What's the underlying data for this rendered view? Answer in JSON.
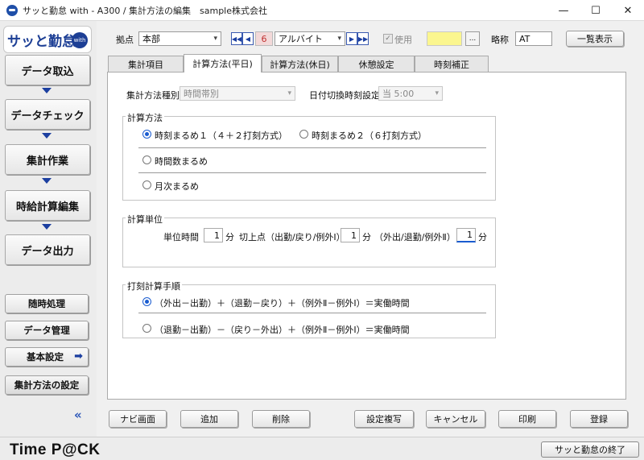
{
  "window": {
    "title": "サッと勤怠 with - A300 / 集計方法の編集　sample株式会社",
    "minimize": "—",
    "maximize": "☐",
    "close": "✕"
  },
  "sidebar": {
    "logo_text": "サッと勤怠",
    "logo_badge": "with",
    "nav": [
      "データ取込",
      "データチェック",
      "集計作業",
      "時給計算編集",
      "データ出力"
    ],
    "sub": [
      "随時処理",
      "データ管理",
      "基本設定",
      "集計方法の設定"
    ],
    "settings_arrow": "➡",
    "collapse": "«"
  },
  "toolbar": {
    "base_label": "拠点",
    "base_value": "本部",
    "prev_btns": [
      "◀◀",
      "◀"
    ],
    "number": "6",
    "type_value": "アルバイト",
    "next_btns": [
      "▶",
      "▶▶"
    ],
    "use_label": "使用",
    "use_check": "✓",
    "ellipsis": "...",
    "abbr_label": "略称",
    "abbr_value": "AT",
    "list_button": "一覧表示"
  },
  "tabs": [
    "集計項目",
    "計算方法(平日)",
    "計算方法(休日)",
    "休憩設定",
    "時刻補正"
  ],
  "form": {
    "method_type_label": "集計方法種別",
    "method_type_value": "時間帯別",
    "date_switch_label": "日付切換時刻設定",
    "date_switch_value": "当 5:00",
    "calc_method_title": "計算方法",
    "calc_options": [
      "時刻まるめ１（４＋２打刻方式）",
      "時刻まるめ２（６打刻方式）",
      "時間数まるめ",
      "月次まるめ"
    ],
    "unit_title": "計算単位",
    "unit_time_label": "単位時間",
    "unit_time_value": "1",
    "unit_suffix": "分",
    "cut_point_label": "切上点（出勤/戻り/例外Ⅰ）",
    "cut_point_value": "1",
    "exit_label": "（外出/退勤/例外Ⅱ）",
    "exit_value": "1",
    "proc_title": "打刻計算手順",
    "proc_options": [
      "（外出－出勤）＋（退勤－戻り）＋（例外Ⅱ－例外Ⅰ）＝実働時間",
      "（退勤－出勤）－（戻り－外出）＋（例外Ⅱ－例外Ⅰ）＝実働時間"
    ]
  },
  "bottom_buttons": [
    "ナビ画面",
    "追加",
    "削除",
    "設定複写",
    "キャンセル",
    "印刷",
    "登録"
  ],
  "footer": {
    "logo": "Time P@CK",
    "exit_button": "サッと勤怠の終了"
  }
}
